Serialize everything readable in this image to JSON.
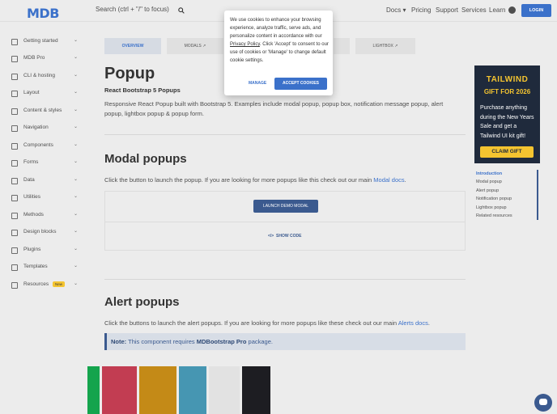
{
  "header": {
    "logo": "MDB",
    "search_placeholder": "Search (ctrl + \"/\" to focus)",
    "nav": [
      "Docs",
      "Pricing",
      "Support",
      "Services",
      "Learn"
    ],
    "login_label": "LOGIN"
  },
  "sidebar": {
    "items": [
      {
        "label": "Getting started"
      },
      {
        "label": "MDB Pro"
      },
      {
        "label": "CLI & hosting"
      },
      {
        "label": "Layout"
      },
      {
        "label": "Content & styles"
      },
      {
        "label": "Navigation"
      },
      {
        "label": "Components"
      },
      {
        "label": "Forms"
      },
      {
        "label": "Data"
      },
      {
        "label": "Utilities"
      },
      {
        "label": "Methods"
      },
      {
        "label": "Design blocks"
      },
      {
        "label": "Plugins"
      },
      {
        "label": "Templates"
      },
      {
        "label": "Resources",
        "badge": "New"
      }
    ]
  },
  "tabs": [
    {
      "label": "OVERVIEW",
      "active": true
    },
    {
      "label": "MODALS",
      "active": false
    },
    {
      "label": "LIGHTBOX",
      "active": false
    }
  ],
  "main": {
    "title": "Popup",
    "subtitle": "React Bootstrap 5 Popups",
    "description": "Responsive React Popup built with Bootstrap 5. Examples include modal popup, popup box, notification message popup, alert popup, lightbox popup & popup form.",
    "modal_heading": "Modal popups",
    "modal_text": "Click the button to launch the popup. If you are looking for more popups like this check out our main",
    "modal_link": "Modal docs",
    "launch_label": "LAUNCH DEMO MODAL",
    "show_code_label": "SHOW CODE",
    "alert_heading": "Alert popups",
    "alert_text": "Click the buttons to launch the alert popups. If you are looking for more popups like these check out our main",
    "alert_link": "Alerts docs",
    "note_label": "Note:",
    "note_text": "This component requires",
    "note_pkg": "MDBootstrap Pro",
    "note_tail": "package."
  },
  "ad": {
    "brand": "TAILWIND",
    "headline": "GIFT FOR 2026",
    "body": "Purchase anything during the New Years Sale and get a Tailwind UI kit gift!",
    "cta": "CLAIM GIFT"
  },
  "toc": {
    "items": [
      "Introduction",
      "Modal popup",
      "Alert popup",
      "Notification popup",
      "Lightbox popup",
      "Related resources"
    ]
  },
  "cookie": {
    "text_1": "We use cookies to enhance your browsing experience, analyze traffic, serve ads, and personalize content in accordance with our",
    "policy_link": "Privacy Policy",
    "text_2": ". Click 'Accept' to consent to our use of cookies or 'Manage' to change default cookie settings.",
    "manage_label": "MANAGE",
    "accept_label": "ACCEPT COOKIES"
  },
  "colors": {
    "primary": "#3b71ca",
    "swatches": [
      "#14a44d",
      "#dc4c64",
      "#e4a11b",
      "#54b4d3",
      "#fbfbfb",
      "#332d2d"
    ]
  }
}
